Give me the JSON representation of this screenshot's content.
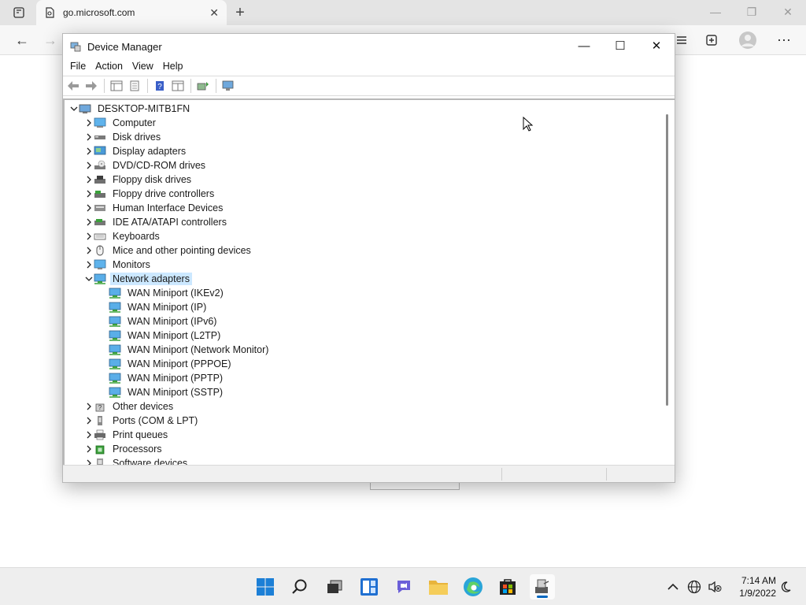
{
  "browser": {
    "tab_title": "go.microsoft.com",
    "tab_close": "✕",
    "new_tab": "+",
    "back": "←",
    "forward": "→",
    "more": "⋯"
  },
  "window": {
    "title": "Device Manager",
    "minimize": "—",
    "maximize": "☐",
    "close": "✕"
  },
  "menu": {
    "file": "File",
    "action": "Action",
    "view": "View",
    "help": "Help"
  },
  "tree": {
    "root": "DESKTOP-MITB1FN",
    "categories": [
      {
        "label": "Computer",
        "icon": "computer-icon"
      },
      {
        "label": "Disk drives",
        "icon": "disk-drive-icon"
      },
      {
        "label": "Display adapters",
        "icon": "display-adapter-icon"
      },
      {
        "label": "DVD/CD-ROM drives",
        "icon": "dvd-drive-icon"
      },
      {
        "label": "Floppy disk drives",
        "icon": "floppy-drive-icon"
      },
      {
        "label": "Floppy drive controllers",
        "icon": "floppy-controller-icon"
      },
      {
        "label": "Human Interface Devices",
        "icon": "hid-icon"
      },
      {
        "label": "IDE ATA/ATAPI controllers",
        "icon": "ide-controller-icon"
      },
      {
        "label": "Keyboards",
        "icon": "keyboard-icon"
      },
      {
        "label": "Mice and other pointing devices",
        "icon": "mouse-icon"
      },
      {
        "label": "Monitors",
        "icon": "monitor-icon"
      },
      {
        "label": "Network adapters",
        "icon": "network-adapter-icon"
      },
      {
        "label": "Other devices",
        "icon": "unknown-device-icon"
      },
      {
        "label": "Ports (COM & LPT)",
        "icon": "port-icon"
      },
      {
        "label": "Print queues",
        "icon": "printer-icon"
      },
      {
        "label": "Processors",
        "icon": "processor-icon"
      },
      {
        "label": "Software devices",
        "icon": "software-device-icon"
      }
    ],
    "network_adapters": [
      "WAN Miniport (IKEv2)",
      "WAN Miniport (IP)",
      "WAN Miniport (IPv6)",
      "WAN Miniport (L2TP)",
      "WAN Miniport (Network Monitor)",
      "WAN Miniport (PPPOE)",
      "WAN Miniport (PPTP)",
      "WAN Miniport (SSTP)"
    ],
    "selected": "Network adapters"
  },
  "taskbar": {
    "time": "7:14 AM",
    "date": "1/9/2022"
  },
  "colors": {
    "accent": "#0067c0",
    "selection": "#cce8ff"
  }
}
